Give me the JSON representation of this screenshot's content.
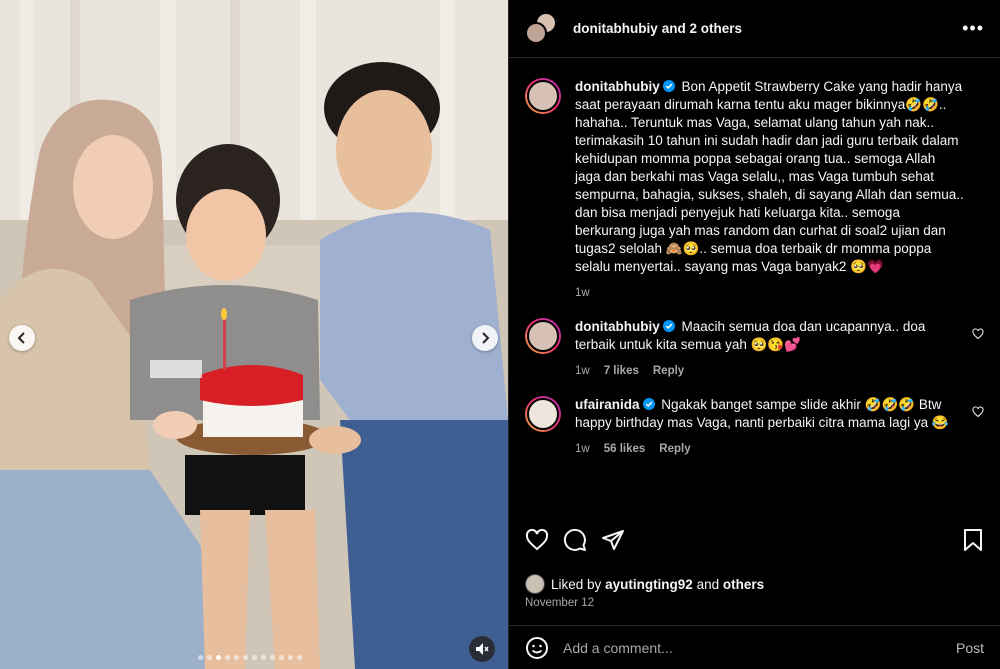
{
  "header": {
    "username": "donitabhubiy",
    "others": "and 2 others",
    "more_icon": "more-horizontal-icon"
  },
  "caption": {
    "username": "donitabhubiy",
    "text": "Bon Appetit Strawberry Cake yang hadir hanya saat perayaan dirumah karna tentu aku mager bikinnya🤣🤣.. hahaha.. Teruntuk mas Vaga, selamat ulang tahun yah nak.. terimakasih 10 tahun ini sudah hadir dan jadi guru terbaik dalam kehidupan momma poppa sebagai orang tua.. semoga Allah jaga dan berkahi mas Vaga selalu,, mas Vaga tumbuh sehat sempurna, bahagia, sukses, shaleh, di sayang Allah dan semua.. dan bisa menjadi penyejuk hati keluarga kita.. semoga berkurang juga yah mas random dan curhat di soal2 ujian dan tugas2 selolah 🙈🥺.. semua doa terbaik dr momma poppa selalu menyertai.. sayang mas Vaga banyak2 🥺💗",
    "time": "1w"
  },
  "comments": [
    {
      "username": "donitabhubiy",
      "text": "Maacih semua doa dan ucapannya.. doa terbaik untuk kita semua yah 🥺😘💕",
      "time": "1w",
      "likes": "7 likes",
      "reply": "Reply"
    },
    {
      "username": "ufairanida",
      "text": "Ngakak banget sampe slide akhir 🤣🤣🤣 Btw happy birthday mas Vaga, nanti perbaiki citra mama lagi ya 😂",
      "time": "1w",
      "likes": "56 likes",
      "reply": "Reply"
    }
  ],
  "liked_by": {
    "prefix": "Liked by",
    "user": "ayutingting92",
    "and": "and",
    "others": "others"
  },
  "date": "November 12",
  "add_comment": {
    "placeholder": "Add a comment...",
    "post": "Post"
  },
  "colors": {
    "background": "#000000",
    "verified": "#0095f6",
    "story_ring": "#e1306c"
  }
}
